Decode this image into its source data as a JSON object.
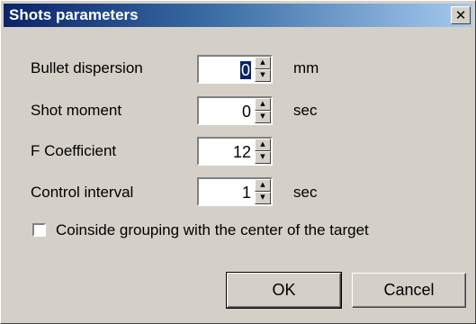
{
  "dialog": {
    "title": "Shots parameters",
    "close_label": "✕"
  },
  "fields": [
    {
      "label": "Bullet dispersion",
      "value": "0",
      "unit": "mm"
    },
    {
      "label": "Shot moment",
      "value": "0",
      "unit": "sec"
    },
    {
      "label": "F Coefficient",
      "value": "12",
      "unit": ""
    },
    {
      "label": "Control interval",
      "value": "1",
      "unit": "sec"
    }
  ],
  "checkbox": {
    "label": "Coinside grouping with the center of the target",
    "checked": false
  },
  "buttons": {
    "ok": "OK",
    "cancel": "Cancel"
  }
}
